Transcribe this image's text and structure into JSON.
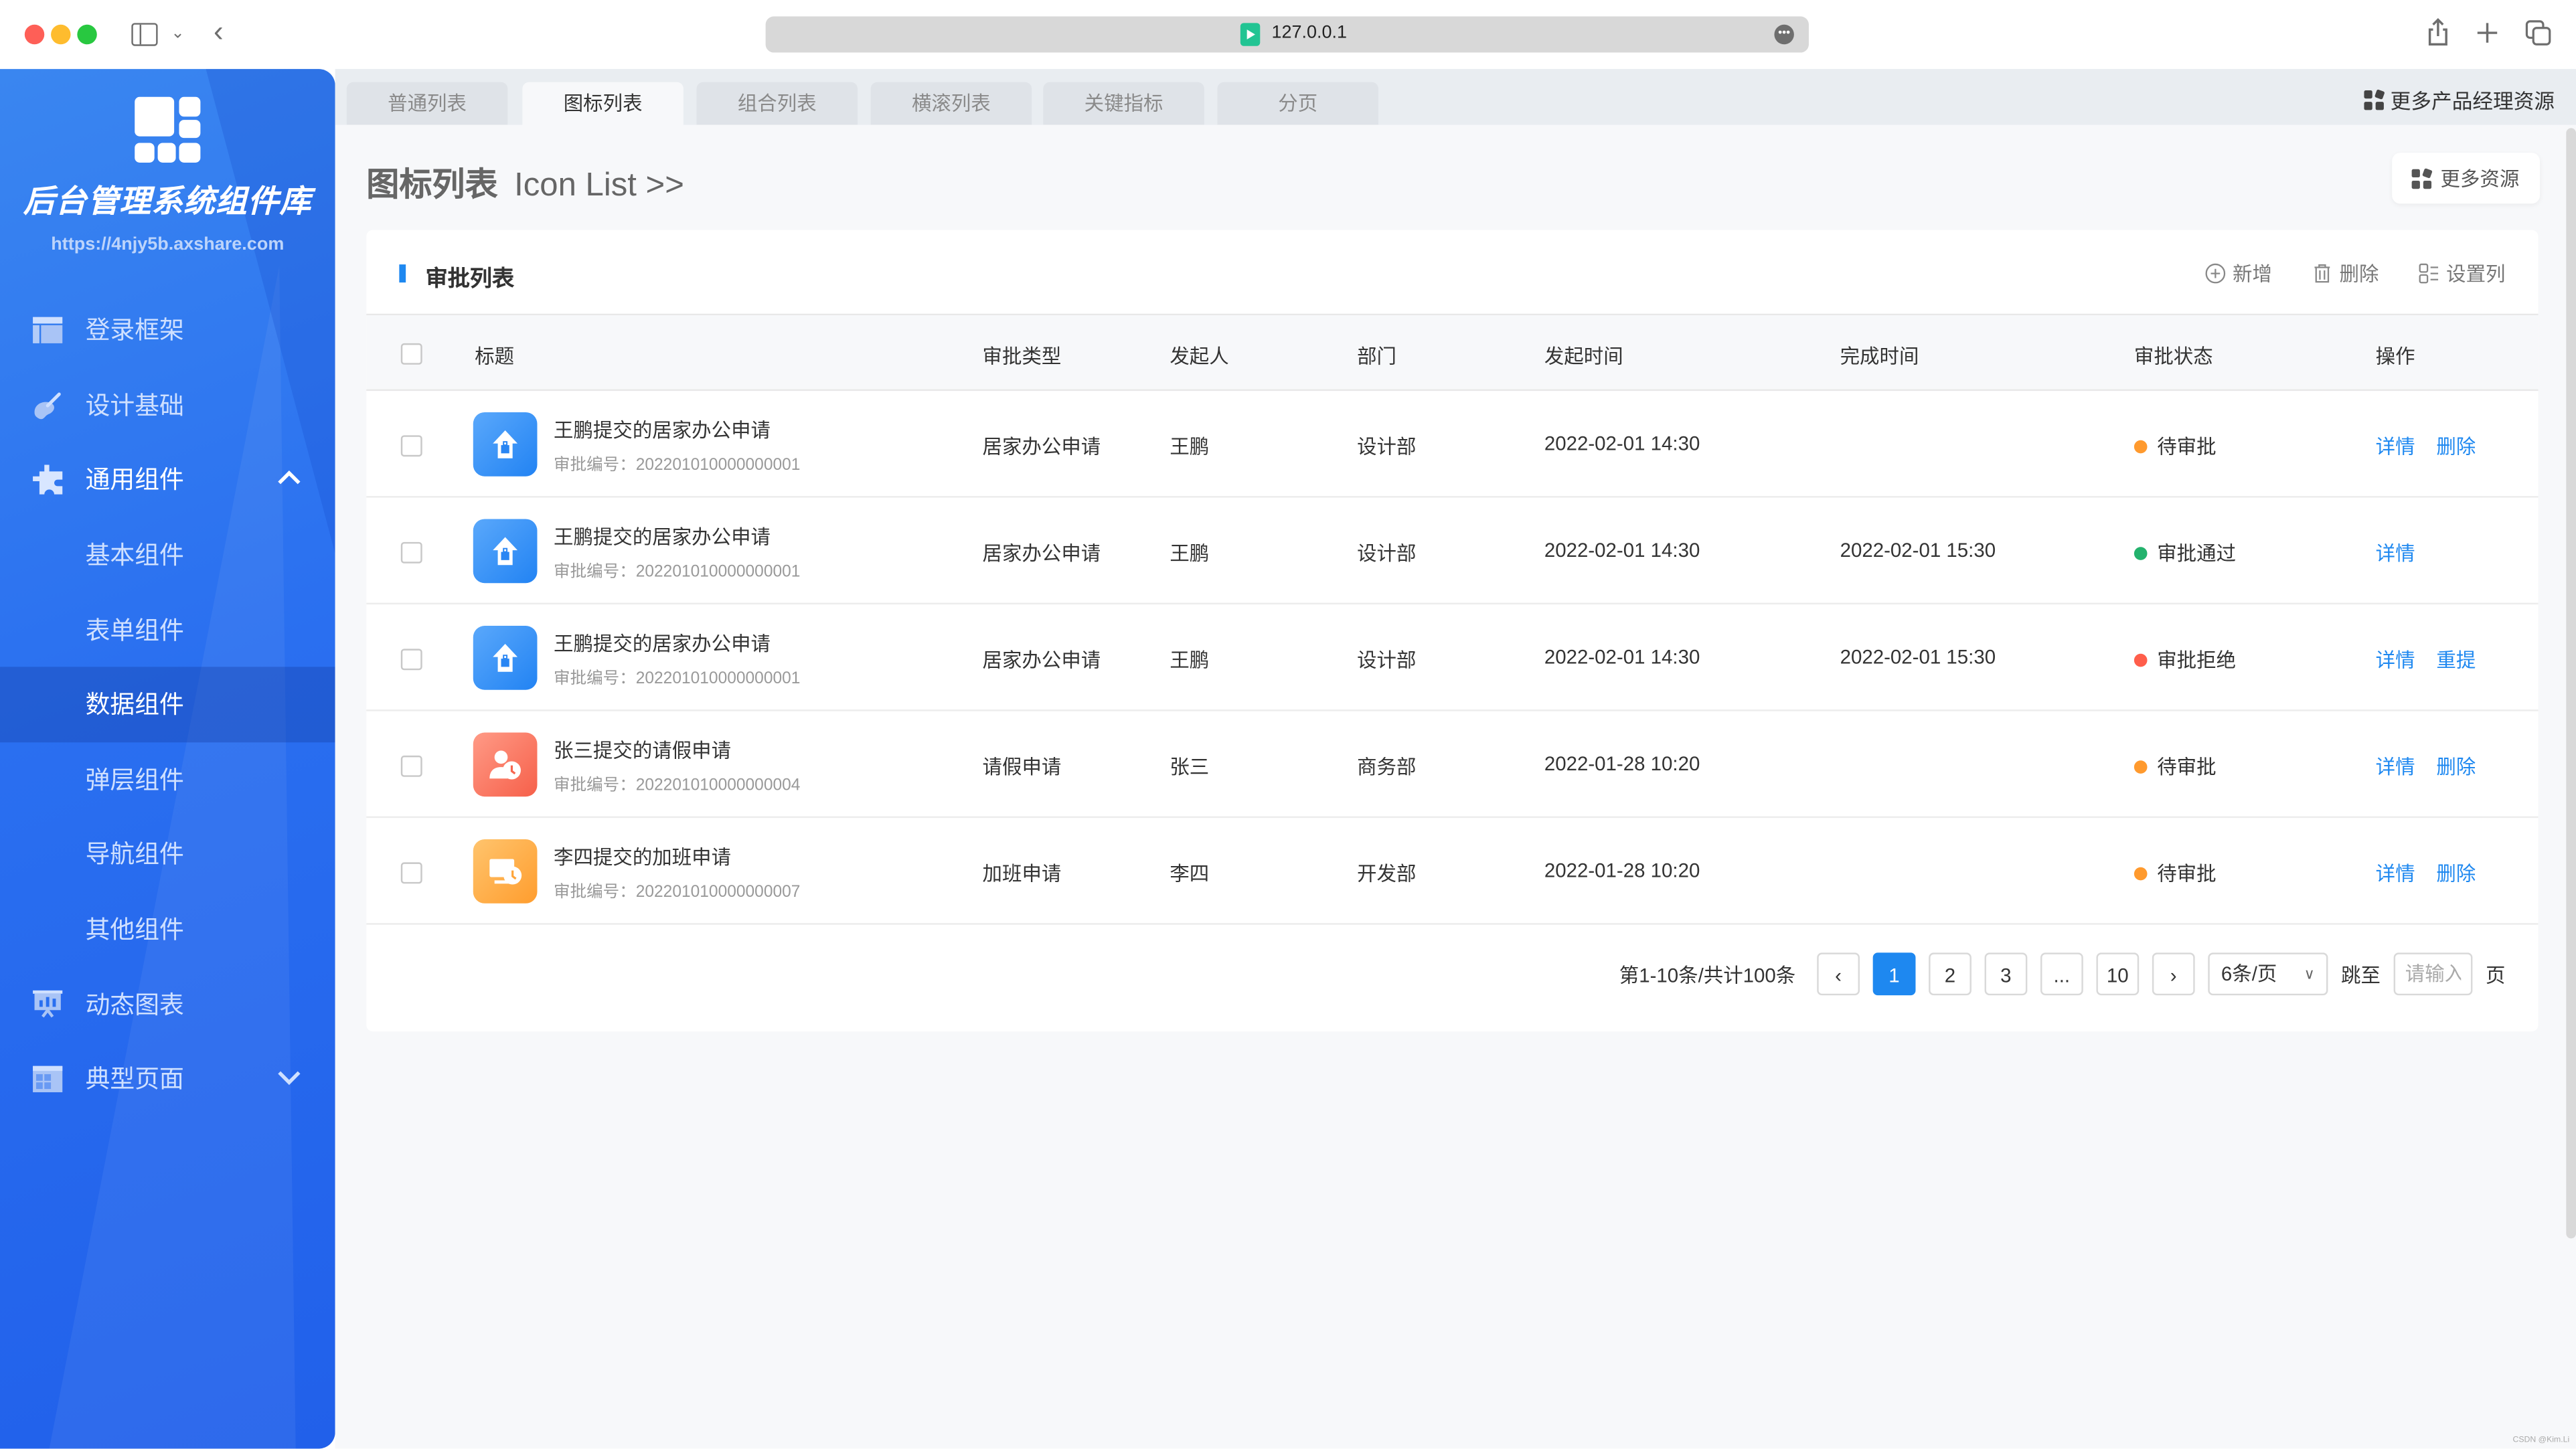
{
  "browser": {
    "url": "127.0.0.1",
    "icons": [
      "sidebar-toggle-icon",
      "chevron-down-icon",
      "back-icon",
      "share-icon",
      "new-tab-icon",
      "tabs-overview-icon"
    ]
  },
  "sidebar": {
    "brand": "后台管理系统组件库",
    "site": "https://4njy5b.axshare.com",
    "items": [
      {
        "label": "登录框架",
        "icon": "layout-icon"
      },
      {
        "label": "设计基础",
        "icon": "palette-icon"
      },
      {
        "label": "通用组件",
        "icon": "puzzle-icon",
        "expanded": true
      },
      {
        "label": "基本组件",
        "sub": true
      },
      {
        "label": "表单组件",
        "sub": true
      },
      {
        "label": "数据组件",
        "sub": true,
        "active": true
      },
      {
        "label": "弹层组件",
        "sub": true
      },
      {
        "label": "导航组件",
        "sub": true
      },
      {
        "label": "其他组件",
        "sub": true
      },
      {
        "label": "动态图表",
        "icon": "presentation-chart-icon"
      },
      {
        "label": "典型页面",
        "icon": "page-template-icon",
        "expanded": false
      }
    ]
  },
  "tabs": [
    {
      "label": "普通列表"
    },
    {
      "label": "图标列表",
      "active": true
    },
    {
      "label": "组合列表"
    },
    {
      "label": "横滚列表"
    },
    {
      "label": "关键指标"
    },
    {
      "label": "分页"
    }
  ],
  "header": {
    "more_pm_resources": "更多产品经理资源",
    "title_cn": "图标列表",
    "title_en": "Icon List >>",
    "more_resources": "更多资源"
  },
  "card": {
    "title": "审批列表",
    "tools": {
      "add": "新增",
      "delete": "删除",
      "columns": "设置列"
    },
    "columns": [
      "标题",
      "审批类型",
      "发起人",
      "部门",
      "发起时间",
      "完成时间",
      "审批状态",
      "操作"
    ],
    "rows": [
      {
        "icon": "home-office-icon",
        "color": "blue",
        "title": "王鹏提交的居家办公申请",
        "no_label": "审批编号：",
        "no": "202201010000000001",
        "type": "居家办公申请",
        "initiator": "王鹏",
        "dept": "设计部",
        "start": "2022-02-01 14:30",
        "end": "",
        "status": "待审批",
        "status_color": "#ff9a2e",
        "actions": [
          "详情",
          "删除"
        ]
      },
      {
        "icon": "home-office-icon",
        "color": "blue",
        "title": "王鹏提交的居家办公申请",
        "no_label": "审批编号：",
        "no": "202201010000000001",
        "type": "居家办公申请",
        "initiator": "王鹏",
        "dept": "设计部",
        "start": "2022-02-01 14:30",
        "end": "2022-02-01 15:30",
        "status": "审批通过",
        "status_color": "#23b26d",
        "actions": [
          "详情"
        ]
      },
      {
        "icon": "home-office-icon",
        "color": "blue",
        "title": "王鹏提交的居家办公申请",
        "no_label": "审批编号：",
        "no": "202201010000000001",
        "type": "居家办公申请",
        "initiator": "王鹏",
        "dept": "设计部",
        "start": "2022-02-01 14:30",
        "end": "2022-02-01 15:30",
        "status": "审批拒绝",
        "status_color": "#ff5e4b",
        "actions": [
          "详情",
          "重提"
        ]
      },
      {
        "icon": "leave-request-icon",
        "color": "red",
        "title": "张三提交的请假申请",
        "no_label": "审批编号：",
        "no": "202201010000000004",
        "type": "请假申请",
        "initiator": "张三",
        "dept": "商务部",
        "start": "2022-01-28 10:20",
        "end": "",
        "status": "待审批",
        "status_color": "#ff9a2e",
        "actions": [
          "详情",
          "删除"
        ]
      },
      {
        "icon": "overtime-request-icon",
        "color": "orange",
        "title": "李四提交的加班申请",
        "no_label": "审批编号：",
        "no": "202201010000000007",
        "type": "加班申请",
        "initiator": "李四",
        "dept": "开发部",
        "start": "2022-01-28 10:20",
        "end": "",
        "status": "待审批",
        "status_color": "#ff9a2e",
        "actions": [
          "详情",
          "删除"
        ]
      }
    ]
  },
  "pagination": {
    "summary": "第1-10条/共计100条",
    "prev": "‹",
    "pages": [
      "1",
      "2",
      "3",
      "...",
      "10"
    ],
    "current": "1",
    "next": "›",
    "page_size": "6条/页",
    "jump_label": "跳至",
    "jump_placeholder": "请输入",
    "page_suffix": "页"
  },
  "colors": {
    "accent": "#1e88f0",
    "sidebar": "#2a6ff0"
  },
  "watermark": "CSDN @Kim.Li"
}
